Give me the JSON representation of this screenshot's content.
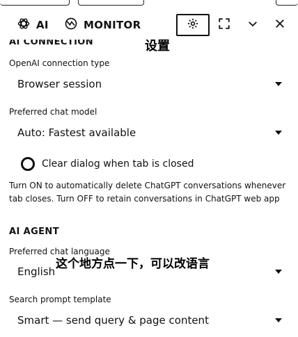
{
  "toolbar": {
    "ai_label": "AI",
    "monitor_label": "MONITOR",
    "icons": {
      "ai": "openai-logo-icon",
      "monitor": "monitor-logo-icon",
      "settings": "gear-icon",
      "fullscreen": "fullscreen-icon",
      "collapse": "chevron-down-icon",
      "close": "close-icon"
    }
  },
  "annotations": {
    "settings_note": "设置",
    "language_note": "这个地方点一下，可以改语言"
  },
  "ai_connection": {
    "title": "AI CONNECTION",
    "connection_type": {
      "label": "OpenAI connection type",
      "value": "Browser session"
    },
    "chat_model": {
      "label": "Preferred chat model",
      "value": "Auto: Fastest available"
    },
    "clear_dialog": {
      "label": "Clear dialog when tab is closed",
      "checked": false
    },
    "help_text": "Turn ON to automatically delete ChatGPT conversations whenever tab closes. Turn OFF to retain conversations in ChatGPT web app"
  },
  "ai_agent": {
    "title": "AI AGENT",
    "chat_language": {
      "label": "Preferred chat language",
      "value": "English"
    },
    "prompt_template": {
      "label": "Search prompt template",
      "value": "Smart — send query & page content"
    }
  }
}
